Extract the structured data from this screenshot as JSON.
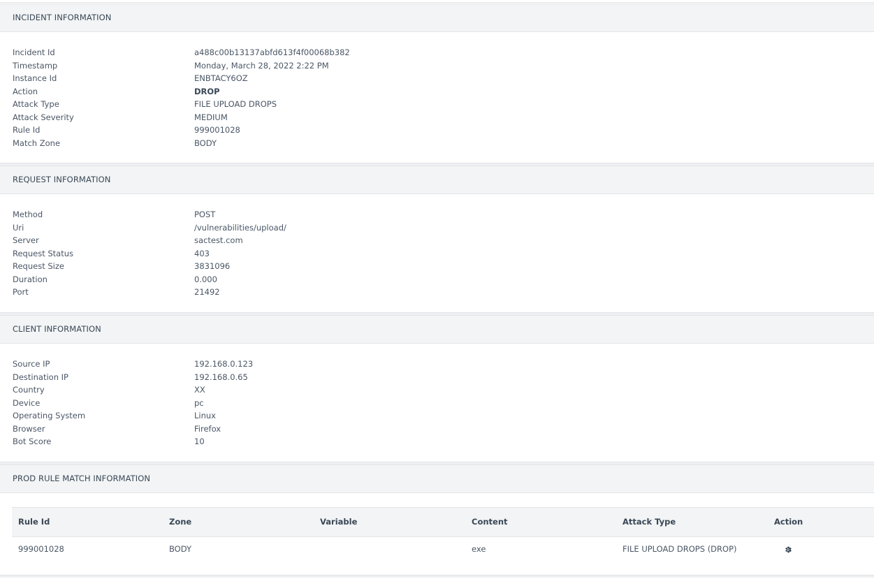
{
  "incident": {
    "title": "INCIDENT INFORMATION",
    "rows": [
      {
        "label": "Incident Id",
        "value": "a488c00b13137abfd613f4f00068b382"
      },
      {
        "label": "Timestamp",
        "value": "Monday, March 28, 2022 2:22 PM"
      },
      {
        "label": "Instance Id",
        "value": "ENBTACY6OZ"
      },
      {
        "label": "Action",
        "value": "DROP"
      },
      {
        "label": "Attack Type",
        "value": "FILE UPLOAD DROPS"
      },
      {
        "label": "Attack Severity",
        "value": "MEDIUM"
      },
      {
        "label": "Rule Id",
        "value": "999001028"
      },
      {
        "label": "Match Zone",
        "value": "BODY"
      }
    ]
  },
  "request": {
    "title": "REQUEST INFORMATION",
    "rows": [
      {
        "label": "Method",
        "value": "POST"
      },
      {
        "label": "Uri",
        "value": "/vulnerabilities/upload/"
      },
      {
        "label": "Server",
        "value": "sactest.com"
      },
      {
        "label": "Request Status",
        "value": "403"
      },
      {
        "label": "Request Size",
        "value": "3831096"
      },
      {
        "label": "Duration",
        "value": "0.000"
      },
      {
        "label": "Port",
        "value": "21492"
      }
    ]
  },
  "client": {
    "title": "CLIENT INFORMATION",
    "rows": [
      {
        "label": "Source IP",
        "value": "192.168.0.123"
      },
      {
        "label": "Destination IP",
        "value": "192.168.0.65"
      },
      {
        "label": "Country",
        "value": "XX"
      },
      {
        "label": "Device",
        "value": "pc"
      },
      {
        "label": "Operating System",
        "value": "Linux"
      },
      {
        "label": "Browser",
        "value": "Firefox"
      },
      {
        "label": "Bot Score",
        "value": "10"
      }
    ]
  },
  "prod_rule": {
    "title": "PROD RULE MATCH INFORMATION",
    "columns": [
      "Rule Id",
      "Zone",
      "Variable",
      "Content",
      "Attack Type",
      "Action"
    ],
    "rows": [
      {
        "rule_id": "999001028",
        "zone": "BODY",
        "variable": "",
        "content": "exe",
        "attack_type": "FILE UPLOAD DROPS (DROP)",
        "action_icon": "gear-icon"
      }
    ]
  }
}
